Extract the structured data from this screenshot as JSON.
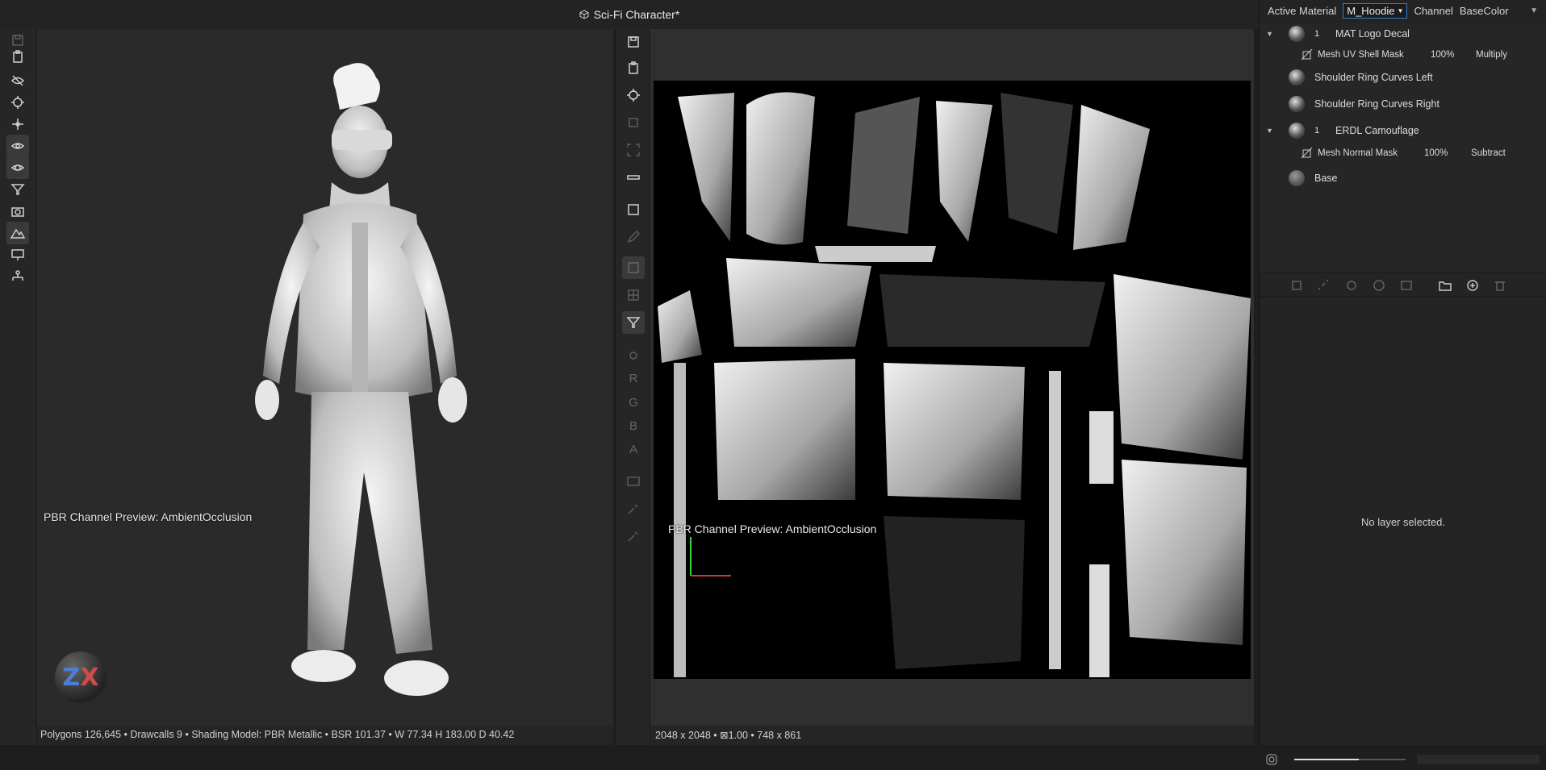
{
  "window": {
    "title": "Sci-Fi Character*"
  },
  "viewport3d": {
    "overlay_label": "PBR Channel Preview: AmbientOcclusion",
    "gizmo_label_z": "Z",
    "gizmo_label_x": "X",
    "status": "Polygons 126,645 • Drawcalls 9 • Shading Model: PBR Metallic • BSR 101.37 • W 77.34 H 183.00 D 40.42"
  },
  "uv_view": {
    "overlay_label": "PBR Channel Preview: AmbientOcclusion",
    "status": "2048 x 2048 • ⊠1.00 • 748 x 861"
  },
  "channel_letters": [
    "R",
    "G",
    "B",
    "A"
  ],
  "right_panel": {
    "active_material_label": "Active Material",
    "active_material_value": "M_Hoodie",
    "channel_label": "Channel",
    "channel_value": "BaseColor",
    "layers": [
      {
        "name": "MAT Logo Decal",
        "index": "1",
        "sub": {
          "name": "Mesh UV Shell Mask",
          "opacity": "100%",
          "blend": "Multiply"
        }
      },
      {
        "name": "Shoulder Ring Curves Left"
      },
      {
        "name": "Shoulder Ring Curves Right"
      },
      {
        "name": "ERDL Camouflage",
        "index": "1",
        "sub": {
          "name": "Mesh Normal Mask",
          "opacity": "100%",
          "blend": "Subtract"
        }
      },
      {
        "name": "Base"
      }
    ],
    "no_selection_text": "No layer selected."
  },
  "bottom": {
    "zoom_fraction": 0.58
  }
}
